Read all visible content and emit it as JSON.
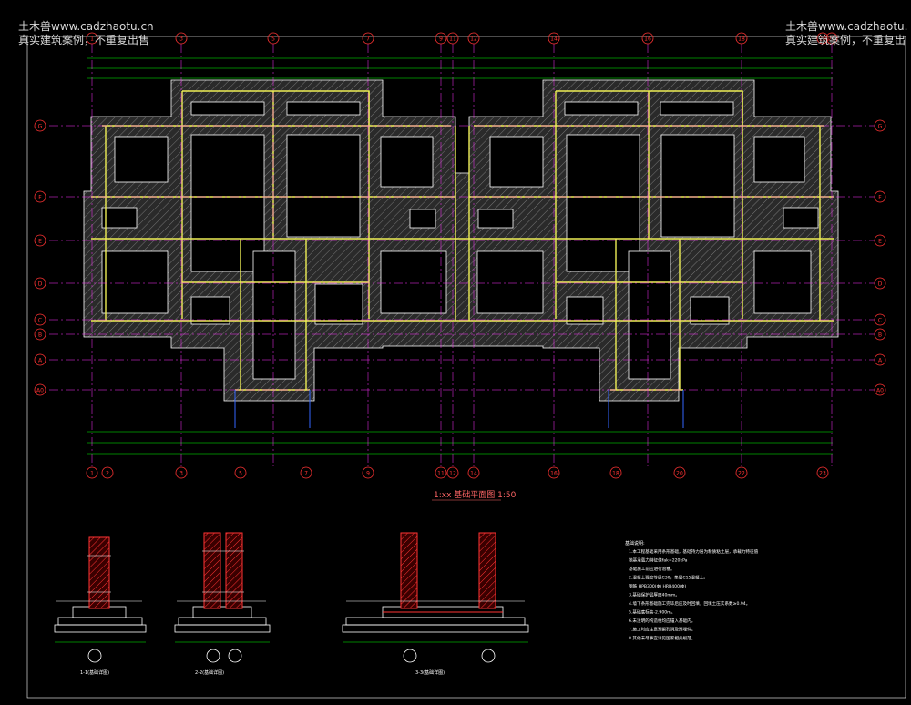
{
  "watermark": {
    "left_line1": "土木兽www.cadzhaotu.cn",
    "left_line2": "真实建筑案例，不重复出售",
    "right_line1": "土木兽www.cadzhaotu.",
    "right_line2": "真实建筑案例，不重复出"
  },
  "plan": {
    "title": "1:xx 基础平面图 1:50",
    "axis_top": [
      "1",
      "3",
      "5",
      "7",
      "9",
      "11",
      "12",
      "14",
      "16",
      "18",
      "20",
      "22"
    ],
    "axis_bottom": [
      "1",
      "2",
      "3",
      "5",
      "7",
      "9",
      "11",
      "12",
      "14",
      "16",
      "18",
      "20",
      "22",
      "23"
    ],
    "axis_left": [
      "G",
      "F",
      "E",
      "D",
      "C",
      "B",
      "A",
      "A0"
    ],
    "axis_right": [
      "G",
      "F",
      "E",
      "D",
      "C",
      "B",
      "A",
      "A0"
    ]
  },
  "sections": {
    "s1_label": "1-1(基础详图)",
    "s2_label": "2-2(基础详图)",
    "s3_label": "3-3(基础详图)"
  },
  "notes": {
    "title": "基础说明:",
    "items": [
      "1.本工程基础采用条形基础，基础持力层为粉质粘土层，承载力特征值",
      "  地基承载力特征值fak=220kPa",
      "  基础施工前应进行验槽。",
      "2.混凝土强度等级C30，垫层C15混凝土。",
      "  钢筋 HPB300(Φ) HRB400(Φ)",
      "3.基础保护层厚度40mm。",
      "4.墙下条形基础施工完毕后应及时回填，回填土压实系数≥0.94。",
      "5.基础底标高-2.900m。",
      "6.未注明的构造柱均应锚入基础内。",
      "7.施工时应注意预留孔洞及预埋件。",
      "8.其他未尽事宜详见国家相关规范。"
    ]
  },
  "colors": {
    "axis_circle": "#ff3333",
    "axis_line": "#ff33ff",
    "wall": "#ffff66",
    "dim": "#00ff00",
    "footing": "#ffffff",
    "hatch_red": "#ff2222"
  }
}
